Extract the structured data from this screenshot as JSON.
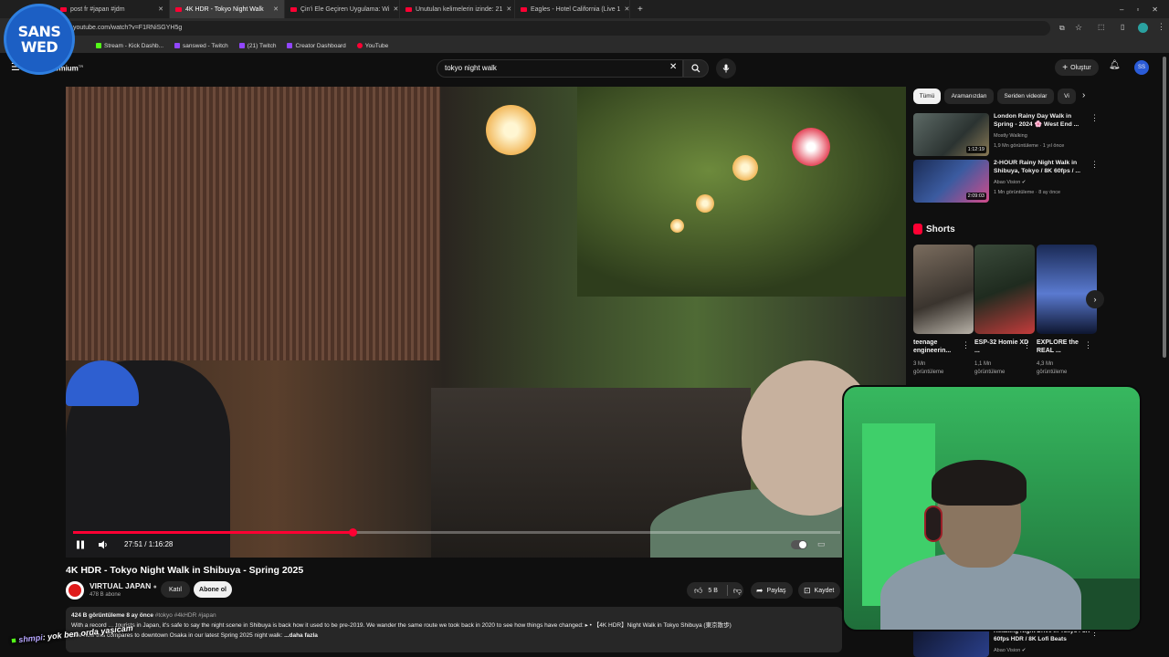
{
  "browser": {
    "tabs": [
      {
        "label": "post fr #japan #jdm"
      },
      {
        "label": "4K HDR - Tokyo Night Walk"
      },
      {
        "label": "Çin'i Ele Geçiren Uygulama: Wi"
      },
      {
        "label": "Unutulan kelimelerin izinde: 21"
      },
      {
        "label": "Eagles - Hotel California (Live 1"
      }
    ],
    "url": "youtube.com/watch?v=F1RNiSGYH5g",
    "bookmarks": [
      "Stream - Kick Dashb...",
      "sanswed - Twitch",
      "(21) Twitch",
      "Creator Dashboard",
      "YouTube"
    ]
  },
  "overlay": {
    "badge_line1": "SANS",
    "badge_line2": "WED",
    "chat_user": "shmpi",
    "chat_message": ": yok ben orda yaşicam"
  },
  "youtube": {
    "logo_suffix": "emium",
    "logo_region": "TR",
    "search_value": "tokyo night walk",
    "create_label": "Oluştur",
    "avatar_initials": "SS"
  },
  "player": {
    "time": "27:51 / 1:16:28",
    "progress_fraction": 0.364,
    "title": "4K HDR - Tokyo Night Walk in Shibuya - Spring 2025",
    "channel": "VIRTUAL JAPAN",
    "subscribers": "478 B abone",
    "join_label": "Katıl",
    "subscribe_label": "Abone ol",
    "likes": "5 B",
    "share_label": "Paylaş",
    "save_label": "Kaydet"
  },
  "description": {
    "views_date": "424 B görüntüleme  8 ay önce",
    "tags": "#tokyo #4kHDR #japan",
    "line1": "With a record … tourists in Japan, it's safe to say the night scene in Shibuya is back how it used to be pre-2019. We wander the same route we took back in 2020 to see how things have changed: ▸ • 【4K HDR】Night Walk in Tokyo Shibuya (東京散歩)",
    "line2": "See how this compares to downtown Osaka in our latest Spring 2025 night walk:",
    "more": "...daha fazla"
  },
  "sidebar": {
    "chips": [
      "Tümü",
      "Aramanızdan",
      "Seriden videolar",
      "Vi"
    ],
    "recommendations": [
      {
        "title": "London Rainy Day Walk in Spring - 2024 🌸 West End ...",
        "channel": "Mostly Walking",
        "meta": "1,9 Mn görüntüleme · 1 yıl önce",
        "duration": "1:12:19"
      },
      {
        "title": "2-HOUR Rainy Night Walk in Shibuya, Tokyo / 8K 60fps / ...",
        "channel": "Abao Vision ✔",
        "meta": "1 Mn görüntüleme · 8 ay önce",
        "duration": "2:09:03"
      }
    ],
    "shorts_label": "Shorts",
    "shorts": [
      {
        "title": "teenage engineerin...",
        "views": "3 Mn görüntüleme"
      },
      {
        "title": "ESP-32 Homie XD ...",
        "views": "1,1 Mn görüntüleme"
      },
      {
        "title": "EXPLORE the REAL ...",
        "views": "4,3 Mn görüntüleme"
      }
    ],
    "bottom_rec": {
      "title": "Relaxing Night Drive in Tokyo / 8K 60fps HDR / 8K Lofi Beats",
      "channel": "Abao Vision ✔"
    }
  },
  "colors": {
    "accent": "#ff0033",
    "background": "#0f0f0f",
    "chip": "#272727",
    "webcam_green": "#2c9a4f"
  }
}
